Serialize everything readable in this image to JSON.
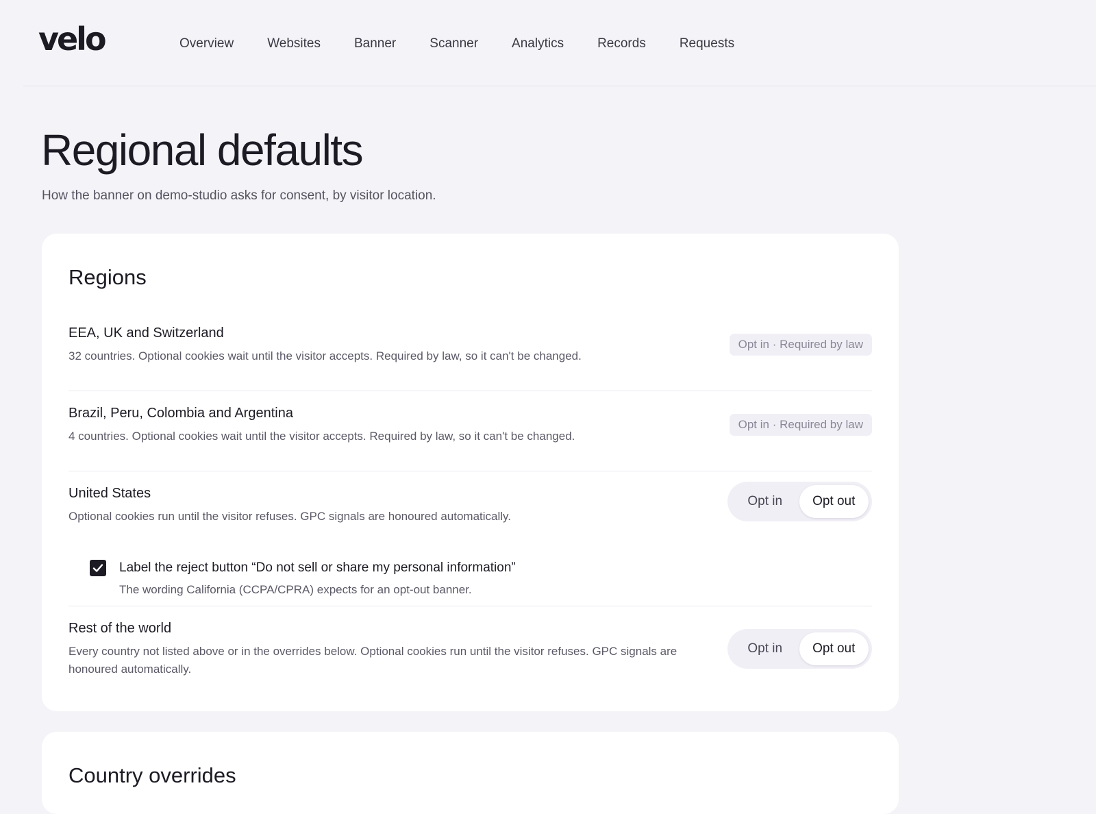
{
  "header": {
    "logo_text": "velo",
    "nav": [
      "Overview",
      "Websites",
      "Banner",
      "Scanner",
      "Analytics",
      "Records",
      "Requests"
    ]
  },
  "page": {
    "title": "Regional defaults",
    "subtitle": "How the banner on demo-studio asks for consent, by visitor location."
  },
  "regions": {
    "title": "Regions",
    "items": [
      {
        "name": "EEA, UK and Switzerland",
        "description": "32 countries. Optional cookies wait until the visitor accepts. Required by law, so it can't be changed.",
        "badge": "Opt in · Required by law"
      },
      {
        "name": "Brazil, Peru, Colombia and Argentina",
        "description": "4 countries. Optional cookies wait until the visitor accepts. Required by law, so it can't be changed.",
        "badge": "Opt in · Required by law"
      },
      {
        "name": "United States",
        "description": "Optional cookies run until the visitor refuses. GPC signals are honoured automatically.",
        "options": [
          "Opt in",
          "Opt out"
        ],
        "selected": "Opt out",
        "checkbox": {
          "checked": true,
          "label": "Label the reject button “Do not sell or share my personal information”",
          "hint": "The wording California (CCPA/CPRA) expects for an opt-out banner."
        }
      },
      {
        "name": "Rest of the world",
        "description": "Every country not listed above or in the overrides below. Optional cookies run until the visitor refuses. GPC signals are honoured automatically.",
        "options": [
          "Opt in",
          "Opt out"
        ],
        "selected": "Opt out"
      }
    ]
  },
  "overrides": {
    "title": "Country overrides"
  },
  "colors": {
    "background": "#f4f3f7",
    "card": "#ffffff",
    "text": "#1c1b24",
    "muted": "#5b5966",
    "badge_bg": "#f1eff6"
  }
}
